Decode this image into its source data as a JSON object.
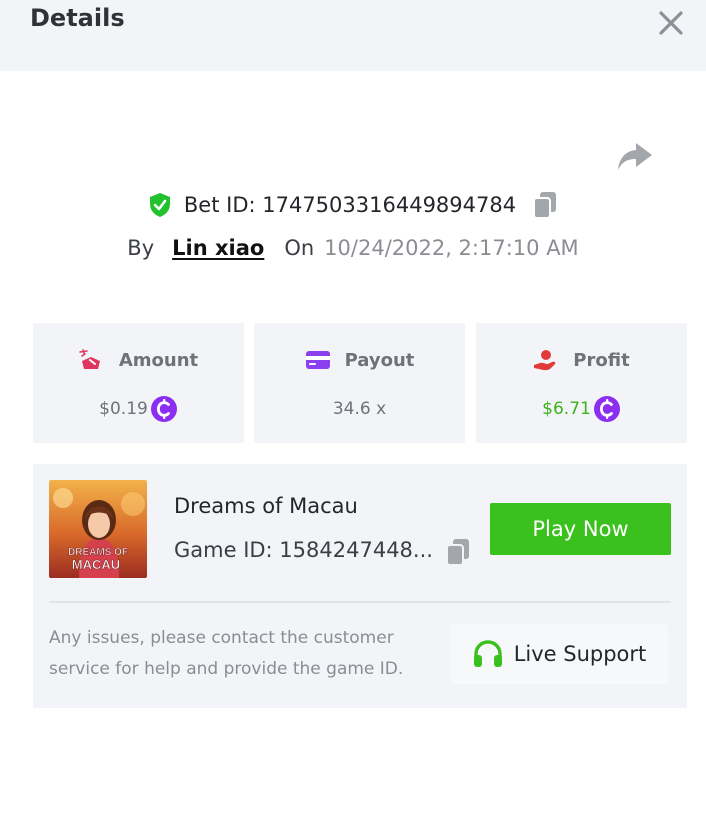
{
  "header": {
    "title": "Details"
  },
  "bet": {
    "id_text": "Bet ID: 1747503316449894784",
    "by_label": "By",
    "user": "Lin xiao",
    "on_label": "On",
    "date": "10/24/2022, 2:17:10 AM"
  },
  "stats": [
    {
      "label": "Amount",
      "value": "$0.19",
      "icon": "amount-icon",
      "color": "#e0355f"
    },
    {
      "label": "Payout",
      "value": "34.6 x",
      "icon": "card-icon",
      "color": "#8a3ff0"
    },
    {
      "label": "Profit",
      "value": "$6.71",
      "icon": "profit-icon",
      "color": "#e03a3a"
    }
  ],
  "game": {
    "name": "Dreams of Macau",
    "id_text": "Game ID: 1584247448...",
    "thumb_line1": "DREAMS OF",
    "thumb_line2": "MACAU",
    "play_label": "Play Now"
  },
  "support": {
    "help_text": "Any issues, please contact the customer service for help and provide the game ID.",
    "button_label": "Live Support"
  },
  "colors": {
    "accent_green": "#3bc11d",
    "coin_purple": "#8b2ef2",
    "shield_green": "#22c22e",
    "profit_green": "#3cb21a"
  }
}
